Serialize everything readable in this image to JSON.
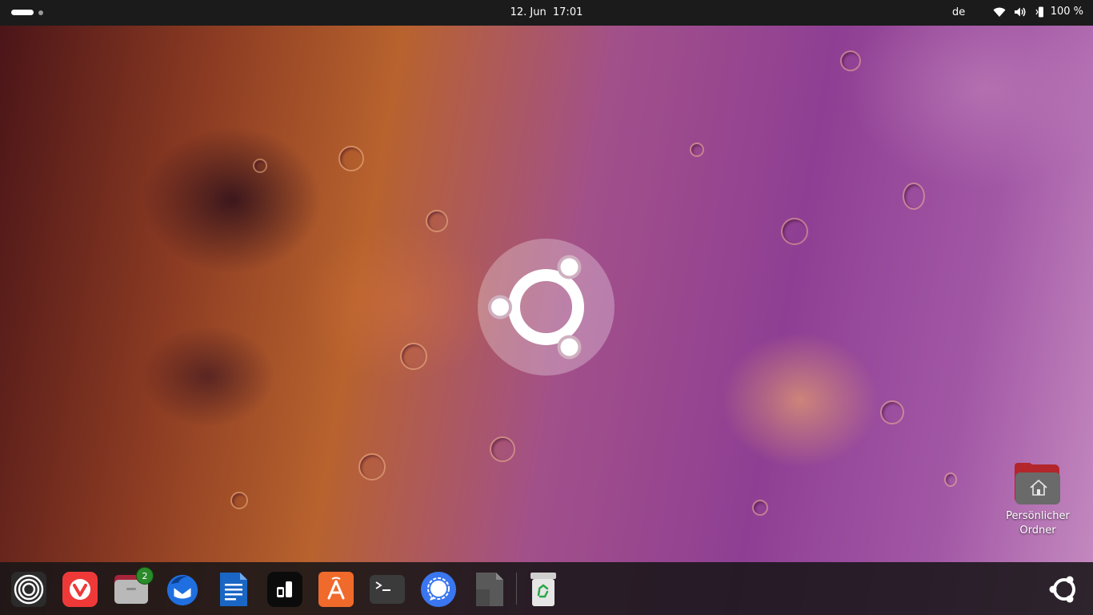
{
  "topbar": {
    "date": "12. Jun",
    "time": "17:01",
    "keyboard_layout": "de",
    "battery_percent": "100 %",
    "icons": [
      "activities-indicator",
      "wifi-icon",
      "volume-icon",
      "battery-icon"
    ]
  },
  "desktop": {
    "home_folder_label_line1": "Persönlicher",
    "home_folder_label_line2": "Ordner"
  },
  "dock": {
    "items": [
      {
        "name": "disk-usage",
        "icon": "rings-icon"
      },
      {
        "name": "vivaldi",
        "icon": "vivaldi-icon"
      },
      {
        "name": "files",
        "icon": "folder-icon",
        "badge": "2"
      },
      {
        "name": "thunderbird",
        "icon": "thunderbird-icon"
      },
      {
        "name": "libreoffice-writer",
        "icon": "writer-icon"
      },
      {
        "name": "app-launcher",
        "icon": "dark-app-icon"
      },
      {
        "name": "app-center",
        "icon": "store-icon"
      },
      {
        "name": "terminal",
        "icon": "terminal-icon"
      },
      {
        "name": "signal",
        "icon": "signal-icon"
      },
      {
        "name": "unknown-app",
        "icon": "grey-app-icon"
      },
      {
        "name": "trash",
        "icon": "trash-icon"
      }
    ],
    "show_apps_icon": "ubuntu-logo-icon"
  },
  "colors": {
    "topbar_bg": "#1b1b1b",
    "dock_bg": "#181618",
    "folder_accent": "#b3262b"
  }
}
